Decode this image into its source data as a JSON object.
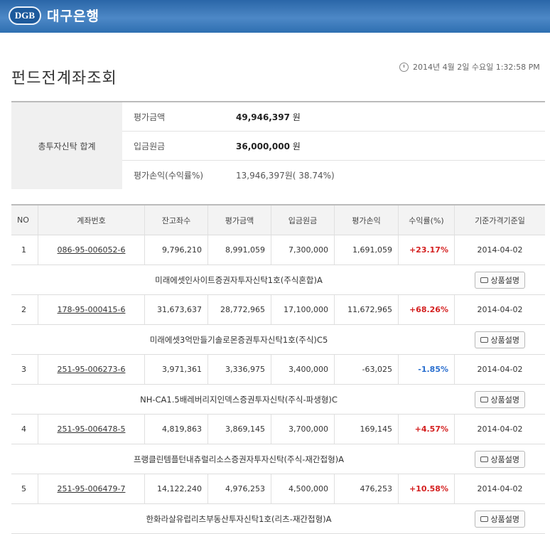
{
  "bank": {
    "logo": "DGB",
    "name": "대구은행"
  },
  "page": {
    "title": "펀드전계좌조회",
    "datetime": "2014년 4월 2일 수요일 1:32:58 PM"
  },
  "summary": {
    "label": "총투자신탁 합계",
    "rows": [
      {
        "key": "평가금액",
        "value": "49,946,397",
        "unit": "원"
      },
      {
        "key": "입금원금",
        "value": "36,000,000",
        "unit": "원"
      },
      {
        "key": "평가손익(수익률%)",
        "value": "13,946,397원( 38.74%)"
      }
    ]
  },
  "table": {
    "headers": [
      "NO",
      "계좌번호",
      "잔고좌수",
      "평가금액",
      "입금원금",
      "평가손익",
      "수익률(%)",
      "기준가격기준일"
    ],
    "detail_button": "상품설명",
    "rows": [
      {
        "no": "1",
        "account": "086-95-006052-6",
        "units": "9,796,210",
        "eval": "8,991,059",
        "principal": "7,300,000",
        "pl": "1,691,059",
        "rate": "+23.17%",
        "date": "2014-04-02",
        "fund": "미래에셋인사이트증권자투자신탁1호(주식혼합)A"
      },
      {
        "no": "2",
        "account": "178-95-000415-6",
        "units": "31,673,637",
        "eval": "28,772,965",
        "principal": "17,100,000",
        "pl": "11,672,965",
        "rate": "+68.26%",
        "date": "2014-04-02",
        "fund": "미래에셋3억만들기솔로몬증권투자신탁1호(주식)C5"
      },
      {
        "no": "3",
        "account": "251-95-006273-6",
        "units": "3,971,361",
        "eval": "3,336,975",
        "principal": "3,400,000",
        "pl": "-63,025",
        "rate": "-1.85%",
        "date": "2014-04-02",
        "fund": "NH-CA1.5배레버리지인덱스증권투자신탁(주식-파생형)C"
      },
      {
        "no": "4",
        "account": "251-95-006478-5",
        "units": "4,819,863",
        "eval": "3,869,145",
        "principal": "3,700,000",
        "pl": "169,145",
        "rate": "+4.57%",
        "date": "2014-04-02",
        "fund": "프랭클린템플턴내츄럴리소스증권자투자신탁(주식-재간접형)A"
      },
      {
        "no": "5",
        "account": "251-95-006479-7",
        "units": "14,122,240",
        "eval": "4,976,253",
        "principal": "4,500,000",
        "pl": "476,253",
        "rate": "+10.58%",
        "date": "2014-04-02",
        "fund": "한화라살유럽리츠부동산투자신탁1호(리츠-재간접형)A"
      }
    ]
  }
}
